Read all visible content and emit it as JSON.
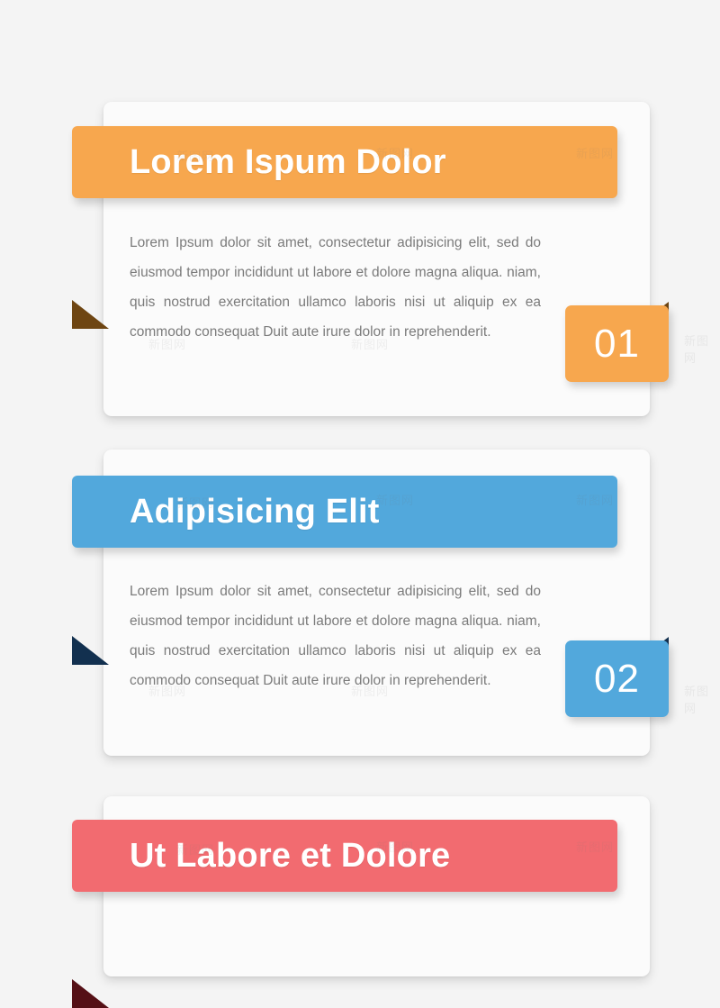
{
  "page": {
    "background_color": "#f4f4f4",
    "watermark_text": "新图网"
  },
  "palette": {
    "orange": "#f7a74e",
    "orange_fold": "#6e4512",
    "blue": "#52a8dc",
    "blue_fold": "#12304f",
    "pink": "#f26b70",
    "pink_fold": "#551016",
    "card": "#fbfbfb",
    "body_text": "#7b7b7b",
    "title_text": "#ffffff"
  },
  "sections": [
    {
      "id": "section-01",
      "title": "Lorem Ispum Dolor",
      "number": "01",
      "color": "orange",
      "body": "Lorem Ipsum dolor sit amet, consectetur adipisicing elit, sed do eiusmod tempor incididunt ut labore et dolore magna aliqua. niam, quis nostrud exercitation ullamco laboris nisi ut aliquip ex ea commodo consequat Duit aute irure dolor in reprehenderit."
    },
    {
      "id": "section-02",
      "title": "Adipisicing Elit",
      "number": "02",
      "color": "blue",
      "body": "Lorem Ipsum dolor sit amet, consectetur adipisicing elit, sed do eiusmod tempor incididunt ut labore et dolore magna aliqua. niam, quis nostrud exercitation ullamco laboris nisi ut aliquip ex ea commodo consequat Duit aute irure dolor in reprehenderit."
    },
    {
      "id": "section-03",
      "title": "Ut Labore et Dolore",
      "number": "",
      "color": "pink",
      "body": ""
    }
  ]
}
